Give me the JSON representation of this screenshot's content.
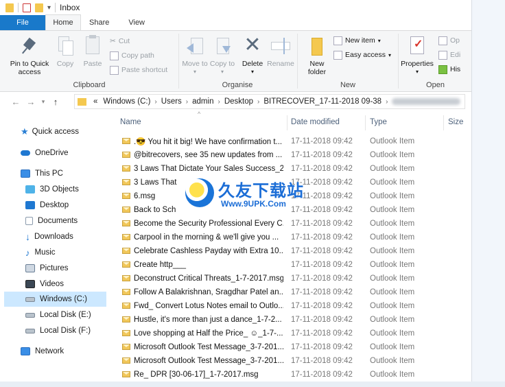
{
  "window": {
    "title": "Inbox"
  },
  "tabs": {
    "file": "File",
    "home": "Home",
    "share": "Share",
    "view": "View"
  },
  "ribbon": {
    "clipboard": {
      "label": "Clipboard",
      "pin": "Pin to Quick access",
      "copy": "Copy",
      "paste": "Paste",
      "cut": "Cut",
      "copy_path": "Copy path",
      "paste_shortcut": "Paste shortcut"
    },
    "organise": {
      "label": "Organise",
      "move_to": "Move to",
      "copy_to": "Copy to",
      "delete": "Delete",
      "rename": "Rename"
    },
    "new": {
      "label": "New",
      "new_folder": "New folder",
      "new_item": "New item",
      "easy_access": "Easy access"
    },
    "open": {
      "label": "Open",
      "properties": "Properties",
      "open": "Op",
      "edit": "Edi",
      "history": "His"
    }
  },
  "address": {
    "crumbs": [
      "Windows (C:)",
      "Users",
      "admin",
      "Desktop",
      "BITRECOVER_17-11-2018 09-38"
    ],
    "overflow": "«"
  },
  "nav": {
    "quick_access": "Quick access",
    "onedrive": "OneDrive",
    "this_pc": "This PC",
    "objects3d": "3D Objects",
    "desktop": "Desktop",
    "documents": "Documents",
    "downloads": "Downloads",
    "music": "Music",
    "pictures": "Pictures",
    "videos": "Videos",
    "windows_c": "Windows (C:)",
    "disk_e": "Local Disk (E:)",
    "disk_f": "Local Disk (F:)",
    "network": "Network"
  },
  "columns": {
    "name": "Name",
    "date": "Date modified",
    "type": "Type",
    "size": "Size"
  },
  "files": [
    {
      "name": ".😎 You hit it big! We have confirmation t...",
      "date": "17-11-2018 09:42",
      "type": "Outlook Item"
    },
    {
      "name": "@bitrecovers, see 35 new updates from ...",
      "date": "17-11-2018 09:42",
      "type": "Outlook Item"
    },
    {
      "name": "3 Laws That Dictate Your Sales Success_2...",
      "date": "17-11-2018 09:42",
      "type": "Outlook Item"
    },
    {
      "name": "3 Laws That",
      "date": "17-11-2018 09:42",
      "type": "Outlook Item"
    },
    {
      "name": "6.msg",
      "date": "17-11-2018 09:42",
      "type": "Outlook Item"
    },
    {
      "name": "Back to Sch",
      "date": "17-11-2018 09:42",
      "type": "Outlook Item"
    },
    {
      "name": "Become the Security Professional Every C...",
      "date": "17-11-2018 09:42",
      "type": "Outlook Item"
    },
    {
      "name": "Carpool in the morning & we'll give you ...",
      "date": "17-11-2018 09:42",
      "type": "Outlook Item"
    },
    {
      "name": "Celebrate Cashless Payday with Extra 10...",
      "date": "17-11-2018 09:42",
      "type": "Outlook Item"
    },
    {
      "name": "Create http___",
      "date": "17-11-2018 09:42",
      "type": "Outlook Item"
    },
    {
      "name": "Deconstruct Critical Threats_1-7-2017.msg",
      "date": "17-11-2018 09:42",
      "type": "Outlook Item"
    },
    {
      "name": "Follow A Balakrishnan, Sragdhar Patel an...",
      "date": "17-11-2018 09:42",
      "type": "Outlook Item"
    },
    {
      "name": "Fwd_ Convert Lotus Notes email to Outlo...",
      "date": "17-11-2018 09:42",
      "type": "Outlook Item"
    },
    {
      "name": "Hustle, it's more than just a dance_1-7-2...",
      "date": "17-11-2018 09:42",
      "type": "Outlook Item"
    },
    {
      "name": "Love shopping at Half the Price_ ☺_1-7-...",
      "date": "17-11-2018 09:42",
      "type": "Outlook Item"
    },
    {
      "name": "Microsoft Outlook Test Message_3-7-201...",
      "date": "17-11-2018 09:42",
      "type": "Outlook Item"
    },
    {
      "name": "Microsoft Outlook Test Message_3-7-201...",
      "date": "17-11-2018 09:42",
      "type": "Outlook Item"
    },
    {
      "name": "Re_ DPR [30-06-17]_1-7-2017.msg",
      "date": "17-11-2018 09:42",
      "type": "Outlook Item"
    }
  ],
  "watermark": {
    "text": "久友下载站",
    "url": "Www.9UPK.Com"
  }
}
